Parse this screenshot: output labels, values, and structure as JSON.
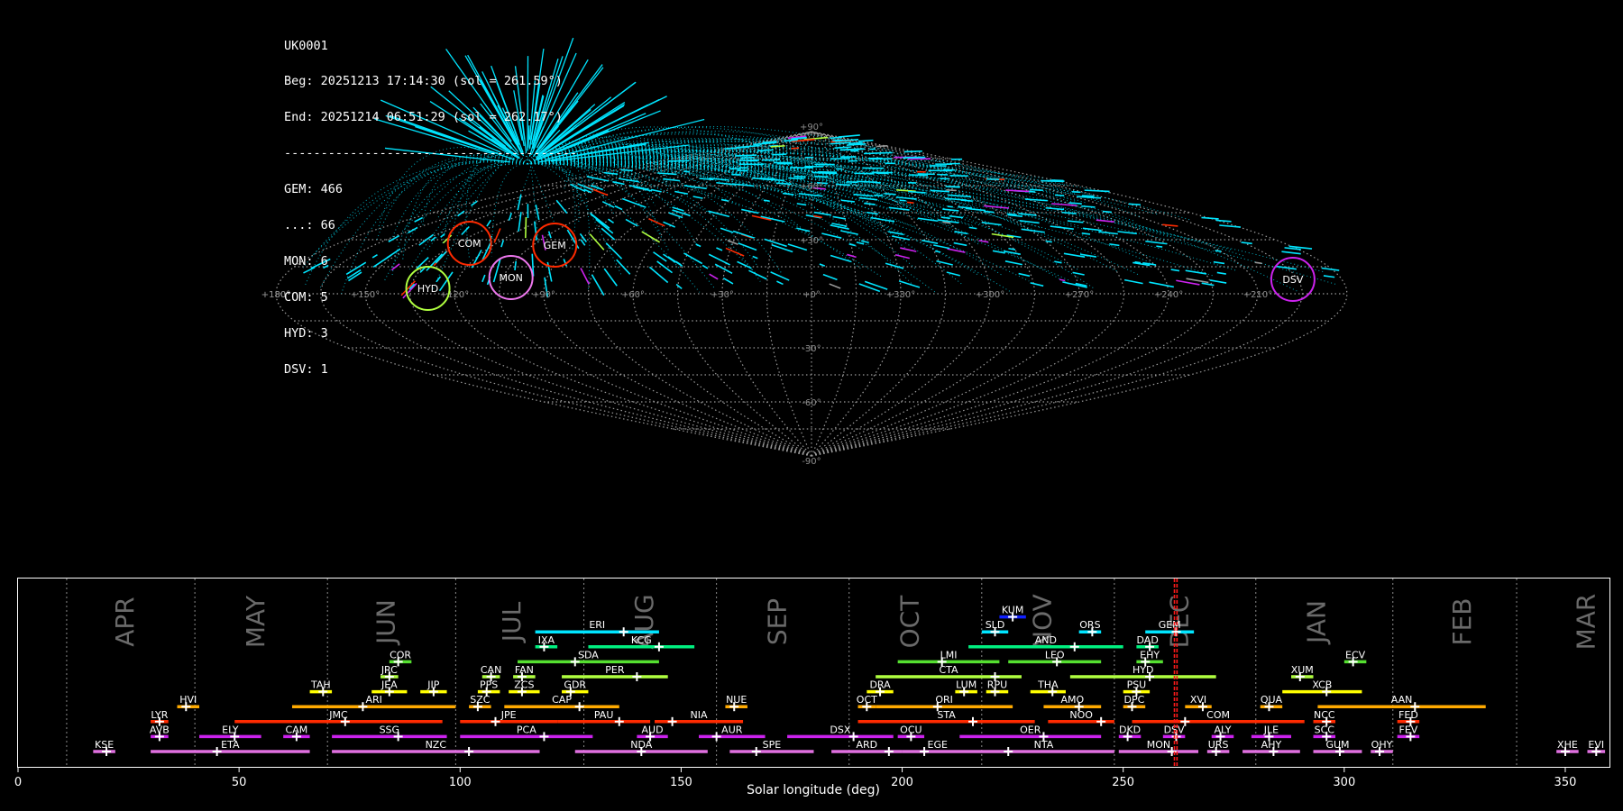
{
  "info": {
    "station": "UK0001",
    "begin": "Beg: 20251213 17:14:30 (sol = 261.59°)",
    "end": "End: 20251214 06:51:29 (sol = 262.17°)",
    "separator": "----------------------------------------",
    "counts": [
      "GEM: 466",
      "...: 66",
      "MON: 6",
      "COM: 5",
      "HYD: 3",
      "DSV: 1"
    ]
  },
  "colors": {
    "cyan": "#00e5ff",
    "red": "#ff2a00",
    "orange": "#ffaa00",
    "yellow": "#ffff00",
    "green": "#55e030",
    "spring": "#00f080",
    "magenta": "#cc22ee",
    "violet": "#ee77ee",
    "pink": "#e070e0",
    "lime": "#b0ff40",
    "blue": "#1020ff"
  },
  "sky_map": {
    "lon_labels": [
      "+180°",
      "+150°",
      "+120°",
      "+90°",
      "+60°",
      "+30°",
      "+0°",
      "+330°",
      "+300°",
      "+270°",
      "+240°",
      "+210°",
      "+180°"
    ],
    "lat_labels": [
      "+90°",
      "+60°",
      "+30°",
      "-30°",
      "-60°",
      "-90°"
    ],
    "radiants": [
      {
        "code": "GEM",
        "lon": 96,
        "lat": 26,
        "color": "red"
      },
      {
        "code": "COM",
        "lon": 129,
        "lat": 27,
        "color": "red"
      },
      {
        "code": "MON",
        "lon": 102,
        "lat": 8,
        "color": "violet"
      },
      {
        "code": "HYD",
        "lon": 129,
        "lat": 2,
        "color": "lime"
      },
      {
        "code": "DSV",
        "lon": 197,
        "lat": 7,
        "color": "magenta"
      }
    ]
  },
  "chart_data": {
    "type": "timeline",
    "xlabel": "Solar longitude (deg)",
    "xlim": [
      0,
      360
    ],
    "xticks": [
      0,
      50,
      100,
      150,
      200,
      250,
      300,
      350
    ],
    "current_sol": [
      261.59,
      262.17
    ],
    "months": [
      {
        "name": "APR",
        "boundary": 11,
        "label_x": 24.5
      },
      {
        "name": "MAY",
        "boundary": 40,
        "label_x": 54
      },
      {
        "name": "JUN",
        "boundary": 70,
        "label_x": 83.5
      },
      {
        "name": "JUL",
        "boundary": 99,
        "label_x": 112
      },
      {
        "name": "AUG",
        "boundary": 128,
        "label_x": 142
      },
      {
        "name": "SEP",
        "boundary": 158,
        "label_x": 172
      },
      {
        "name": "OCT",
        "boundary": 188,
        "label_x": 202
      },
      {
        "name": "NOV",
        "boundary": 218,
        "label_x": 232
      },
      {
        "name": "DEC",
        "boundary": 248,
        "label_x": 263
      },
      {
        "name": "JAN",
        "boundary": 280,
        "label_x": 294
      },
      {
        "name": "FEB",
        "boundary": 311,
        "label_x": 327
      },
      {
        "name": "MAR",
        "boundary": 339,
        "label_x": 355
      }
    ],
    "showers": [
      {
        "code": "KUM",
        "start": 222,
        "end": 228,
        "peak": 225,
        "row": 10,
        "color": "blue"
      },
      {
        "code": "ERI",
        "start": 117,
        "end": 145,
        "peak": 137,
        "row": 9,
        "color": "cyan"
      },
      {
        "code": "SLD",
        "start": 218,
        "end": 224,
        "peak": 221,
        "row": 9,
        "color": "cyan"
      },
      {
        "code": "ORS",
        "start": 240,
        "end": 245,
        "peak": 243,
        "row": 9,
        "color": "cyan"
      },
      {
        "code": "GEM",
        "start": 255,
        "end": 266,
        "peak": 262,
        "row": 9,
        "color": "cyan"
      },
      {
        "code": "IXA",
        "start": 117,
        "end": 122,
        "peak": 119,
        "row": 8,
        "color": "spring"
      },
      {
        "code": "KCG",
        "start": 129,
        "end": 153,
        "peak": 145,
        "row": 8,
        "color": "spring"
      },
      {
        "code": "AND",
        "start": 215,
        "end": 250,
        "peak": 239,
        "row": 8,
        "color": "spring"
      },
      {
        "code": "DAD",
        "start": 253,
        "end": 258,
        "peak": 256,
        "row": 8,
        "color": "spring"
      },
      {
        "code": "COR",
        "start": 84,
        "end": 89,
        "peak": 86,
        "row": 7,
        "color": "green"
      },
      {
        "code": "SDA",
        "start": 113,
        "end": 145,
        "peak": 126,
        "row": 7,
        "color": "green"
      },
      {
        "code": "LMI",
        "start": 199,
        "end": 222,
        "peak": 209,
        "row": 7,
        "color": "green"
      },
      {
        "code": "LEO",
        "start": 224,
        "end": 245,
        "peak": 235,
        "row": 7,
        "color": "green"
      },
      {
        "code": "EHY",
        "start": 253,
        "end": 259,
        "peak": 255,
        "row": 7,
        "color": "green"
      },
      {
        "code": "ECV",
        "start": 300,
        "end": 305,
        "peak": 302,
        "row": 7,
        "color": "green"
      },
      {
        "code": "JRC",
        "start": 82,
        "end": 86,
        "peak": 84,
        "row": 6,
        "color": "lime"
      },
      {
        "code": "CAN",
        "start": 105,
        "end": 109,
        "peak": 107,
        "row": 6,
        "color": "lime"
      },
      {
        "code": "FAN",
        "start": 112,
        "end": 117,
        "peak": 114,
        "row": 6,
        "color": "lime"
      },
      {
        "code": "PER",
        "start": 123,
        "end": 147,
        "peak": 140,
        "row": 6,
        "color": "lime"
      },
      {
        "code": "CTA",
        "start": 194,
        "end": 227,
        "peak": 221,
        "row": 6,
        "color": "lime"
      },
      {
        "code": "HYD",
        "start": 238,
        "end": 271,
        "peak": 256,
        "row": 6,
        "color": "lime"
      },
      {
        "code": "XUM",
        "start": 288,
        "end": 293,
        "peak": 290,
        "row": 6,
        "color": "lime"
      },
      {
        "code": "TAH",
        "start": 66,
        "end": 71,
        "peak": 69,
        "row": 5,
        "color": "yellow"
      },
      {
        "code": "JEA",
        "start": 80,
        "end": 88,
        "peak": 84,
        "row": 5,
        "color": "yellow"
      },
      {
        "code": "JIP",
        "start": 91,
        "end": 97,
        "peak": 94,
        "row": 5,
        "color": "yellow"
      },
      {
        "code": "PPS",
        "start": 104,
        "end": 109,
        "peak": 106,
        "row": 5,
        "color": "yellow"
      },
      {
        "code": "ZCS",
        "start": 111,
        "end": 118,
        "peak": 114,
        "row": 5,
        "color": "yellow"
      },
      {
        "code": "GDR",
        "start": 123,
        "end": 129,
        "peak": 125,
        "row": 5,
        "color": "yellow"
      },
      {
        "code": "DRA",
        "start": 192,
        "end": 198,
        "peak": 195,
        "row": 5,
        "color": "yellow"
      },
      {
        "code": "LUM",
        "start": 212,
        "end": 217,
        "peak": 214,
        "row": 5,
        "color": "yellow"
      },
      {
        "code": "RPU",
        "start": 219,
        "end": 224,
        "peak": 221,
        "row": 5,
        "color": "yellow"
      },
      {
        "code": "THA",
        "start": 229,
        "end": 237,
        "peak": 234,
        "row": 5,
        "color": "yellow"
      },
      {
        "code": "PSU",
        "start": 250,
        "end": 256,
        "peak": 253,
        "row": 5,
        "color": "yellow"
      },
      {
        "code": "XCB",
        "start": 286,
        "end": 304,
        "peak": 296,
        "row": 5,
        "color": "yellow"
      },
      {
        "code": "HVI",
        "start": 36,
        "end": 41,
        "peak": 38,
        "row": 4,
        "color": "orange"
      },
      {
        "code": "ARI",
        "start": 62,
        "end": 99,
        "peak": 78,
        "row": 4,
        "color": "orange"
      },
      {
        "code": "SZC",
        "start": 102,
        "end": 107,
        "peak": 104,
        "row": 4,
        "color": "orange"
      },
      {
        "code": "CAP",
        "start": 110,
        "end": 136,
        "peak": 127,
        "row": 4,
        "color": "orange"
      },
      {
        "code": "NUE",
        "start": 160,
        "end": 165,
        "peak": 162,
        "row": 4,
        "color": "orange"
      },
      {
        "code": "OCT",
        "start": 190,
        "end": 194,
        "peak": 192,
        "row": 4,
        "color": "orange"
      },
      {
        "code": "ORI",
        "start": 194,
        "end": 225,
        "peak": 208,
        "row": 4,
        "color": "orange"
      },
      {
        "code": "AMO",
        "start": 232,
        "end": 245,
        "peak": 240,
        "row": 4,
        "color": "orange"
      },
      {
        "code": "DPC",
        "start": 250,
        "end": 255,
        "peak": 252,
        "row": 4,
        "color": "orange"
      },
      {
        "code": "XVI",
        "start": 264,
        "end": 270,
        "peak": 268,
        "row": 4,
        "color": "orange"
      },
      {
        "code": "QUA",
        "start": 281,
        "end": 286,
        "peak": 283,
        "row": 4,
        "color": "orange"
      },
      {
        "code": "AAN",
        "start": 294,
        "end": 332,
        "peak": 316,
        "row": 4,
        "color": "orange"
      },
      {
        "code": "LYR",
        "start": 30,
        "end": 34,
        "peak": 32,
        "row": 3,
        "color": "red"
      },
      {
        "code": "JMC",
        "start": 49,
        "end": 96,
        "peak": 74,
        "row": 3,
        "color": "red"
      },
      {
        "code": "JPE",
        "start": 100,
        "end": 122,
        "peak": 108,
        "row": 3,
        "color": "red"
      },
      {
        "code": "PAU",
        "start": 122,
        "end": 143,
        "peak": 136,
        "row": 3,
        "color": "red"
      },
      {
        "code": "NIA",
        "start": 144,
        "end": 164,
        "peak": 148,
        "row": 3,
        "color": "red"
      },
      {
        "code": "STA",
        "start": 190,
        "end": 230,
        "peak": 216,
        "row": 3,
        "color": "red"
      },
      {
        "code": "NOO",
        "start": 233,
        "end": 248,
        "peak": 245,
        "row": 3,
        "color": "red"
      },
      {
        "code": "COM",
        "start": 252,
        "end": 291,
        "peak": 264,
        "row": 3,
        "color": "red"
      },
      {
        "code": "NCC",
        "start": 293,
        "end": 298,
        "peak": 296,
        "row": 3,
        "color": "red"
      },
      {
        "code": "FED",
        "start": 312,
        "end": 317,
        "peak": 315,
        "row": 3,
        "color": "red"
      },
      {
        "code": "AVB",
        "start": 30,
        "end": 34,
        "peak": 32,
        "row": 2,
        "color": "magenta"
      },
      {
        "code": "ELY",
        "start": 41,
        "end": 55,
        "peak": 49,
        "row": 2,
        "color": "magenta"
      },
      {
        "code": "CAM",
        "start": 60,
        "end": 66,
        "peak": 63,
        "row": 2,
        "color": "magenta"
      },
      {
        "code": "SSG",
        "start": 71,
        "end": 97,
        "peak": 86,
        "row": 2,
        "color": "magenta"
      },
      {
        "code": "PCA",
        "start": 100,
        "end": 130,
        "peak": 119,
        "row": 2,
        "color": "magenta"
      },
      {
        "code": "AUD",
        "start": 140,
        "end": 147,
        "peak": 143,
        "row": 2,
        "color": "magenta"
      },
      {
        "code": "AUR",
        "start": 154,
        "end": 169,
        "peak": 158,
        "row": 2,
        "color": "magenta"
      },
      {
        "code": "DSX",
        "start": 174,
        "end": 198,
        "peak": 189,
        "row": 2,
        "color": "magenta"
      },
      {
        "code": "OCU",
        "start": 199,
        "end": 205,
        "peak": 202,
        "row": 2,
        "color": "magenta"
      },
      {
        "code": "OER",
        "start": 213,
        "end": 245,
        "peak": 232,
        "row": 2,
        "color": "magenta"
      },
      {
        "code": "DKD",
        "start": 249,
        "end": 254,
        "peak": 251,
        "row": 2,
        "color": "magenta"
      },
      {
        "code": "DSV",
        "start": 259,
        "end": 264,
        "peak": 262,
        "row": 2,
        "color": "magenta"
      },
      {
        "code": "ALY",
        "start": 270,
        "end": 275,
        "peak": 272,
        "row": 2,
        "color": "magenta"
      },
      {
        "code": "JLE",
        "start": 279,
        "end": 288,
        "peak": 283,
        "row": 2,
        "color": "magenta"
      },
      {
        "code": "SCC",
        "start": 293,
        "end": 298,
        "peak": 296,
        "row": 2,
        "color": "magenta"
      },
      {
        "code": "FEV",
        "start": 312,
        "end": 317,
        "peak": 315,
        "row": 2,
        "color": "magenta"
      },
      {
        "code": "KSE",
        "start": 17,
        "end": 22,
        "peak": 20,
        "row": 1,
        "color": "pink"
      },
      {
        "code": "ETA",
        "start": 30,
        "end": 66,
        "peak": 45,
        "row": 1,
        "color": "pink"
      },
      {
        "code": "NZC",
        "start": 71,
        "end": 118,
        "peak": 102,
        "row": 1,
        "color": "pink"
      },
      {
        "code": "NDA",
        "start": 126,
        "end": 156,
        "peak": 141,
        "row": 1,
        "color": "pink"
      },
      {
        "code": "SPE",
        "start": 161,
        "end": 180,
        "peak": 167,
        "row": 1,
        "color": "pink"
      },
      {
        "code": "ARD",
        "start": 184,
        "end": 200,
        "peak": 197,
        "row": 1,
        "color": "pink"
      },
      {
        "code": "EGE",
        "start": 200,
        "end": 216,
        "peak": 205,
        "row": 1,
        "color": "pink"
      },
      {
        "code": "NTA",
        "start": 216,
        "end": 248,
        "peak": 224,
        "row": 1,
        "color": "pink"
      },
      {
        "code": "MON",
        "start": 249,
        "end": 267,
        "peak": 261,
        "row": 1,
        "color": "pink"
      },
      {
        "code": "URS",
        "start": 269,
        "end": 274,
        "peak": 271,
        "row": 1,
        "color": "pink"
      },
      {
        "code": "AHY",
        "start": 277,
        "end": 290,
        "peak": 284,
        "row": 1,
        "color": "pink"
      },
      {
        "code": "GUM",
        "start": 293,
        "end": 304,
        "peak": 299,
        "row": 1,
        "color": "pink"
      },
      {
        "code": "OHY",
        "start": 306,
        "end": 311,
        "peak": 308,
        "row": 1,
        "color": "pink"
      },
      {
        "code": "XHE",
        "start": 348,
        "end": 353,
        "peak": 350,
        "row": 1,
        "color": "pink"
      },
      {
        "code": "EVI",
        "start": 355,
        "end": 359,
        "peak": 357,
        "row": 1,
        "color": "pink"
      }
    ]
  }
}
